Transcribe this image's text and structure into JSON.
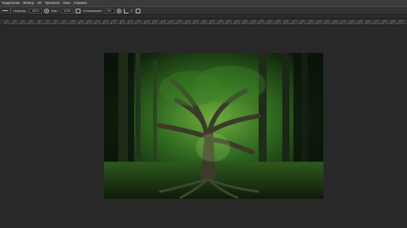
{
  "menubar": {
    "items": [
      "Выделение",
      "Фильтр",
      "3D",
      "Просмотр",
      "Окно",
      "Справка"
    ]
  },
  "options_bar": {
    "opacity_label": "Непрозр.:",
    "opacity_value": "100%",
    "flow_label": "Наж.:",
    "flow_value": "100%",
    "smoothing_label": "Сглаживание:",
    "smoothing_value": "0%",
    "angle_value": "0°"
  },
  "ruler": {
    "labels": [
      "20",
      "30",
      "40",
      "50",
      "60",
      "70",
      "80",
      "90",
      "100",
      "110",
      "120",
      "130",
      "140",
      "150",
      "160",
      "170",
      "180",
      "190",
      "200",
      "210",
      "220",
      "230",
      "240",
      "250",
      "260",
      "270",
      "280",
      "290",
      "300",
      "310",
      "320",
      "330",
      "340",
      "350",
      "360",
      "370",
      "380",
      "390",
      "400",
      "410",
      "420",
      "430",
      "440",
      "450",
      "460",
      "470",
      "480",
      "490",
      "500"
    ]
  },
  "canvas": {
    "content": "forest-tree-image",
    "accent_color": "#2f7a22"
  }
}
